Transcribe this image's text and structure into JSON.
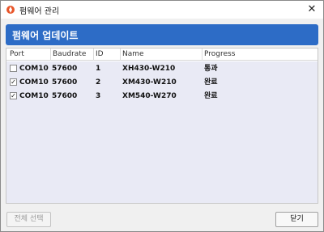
{
  "window": {
    "title": "펌웨어 관리",
    "close_glyph": "✕"
  },
  "header": {
    "title": "펌웨어 업데이트",
    "color": "#2d6cc6"
  },
  "table": {
    "columns": [
      "Port",
      "Baudrate",
      "ID",
      "Name",
      "Progress"
    ],
    "rows": [
      {
        "checked": false,
        "port": "COM10",
        "baudrate": "57600",
        "id": "1",
        "name": "XH430-W210",
        "progress": "통과"
      },
      {
        "checked": true,
        "port": "COM10",
        "baudrate": "57600",
        "id": "2",
        "name": "XM430-W210",
        "progress": "완료"
      },
      {
        "checked": true,
        "port": "COM10",
        "baudrate": "57600",
        "id": "3",
        "name": "XM540-W270",
        "progress": "완료"
      }
    ]
  },
  "buttons": {
    "select_all": "전체 선택",
    "close": "닫기"
  }
}
